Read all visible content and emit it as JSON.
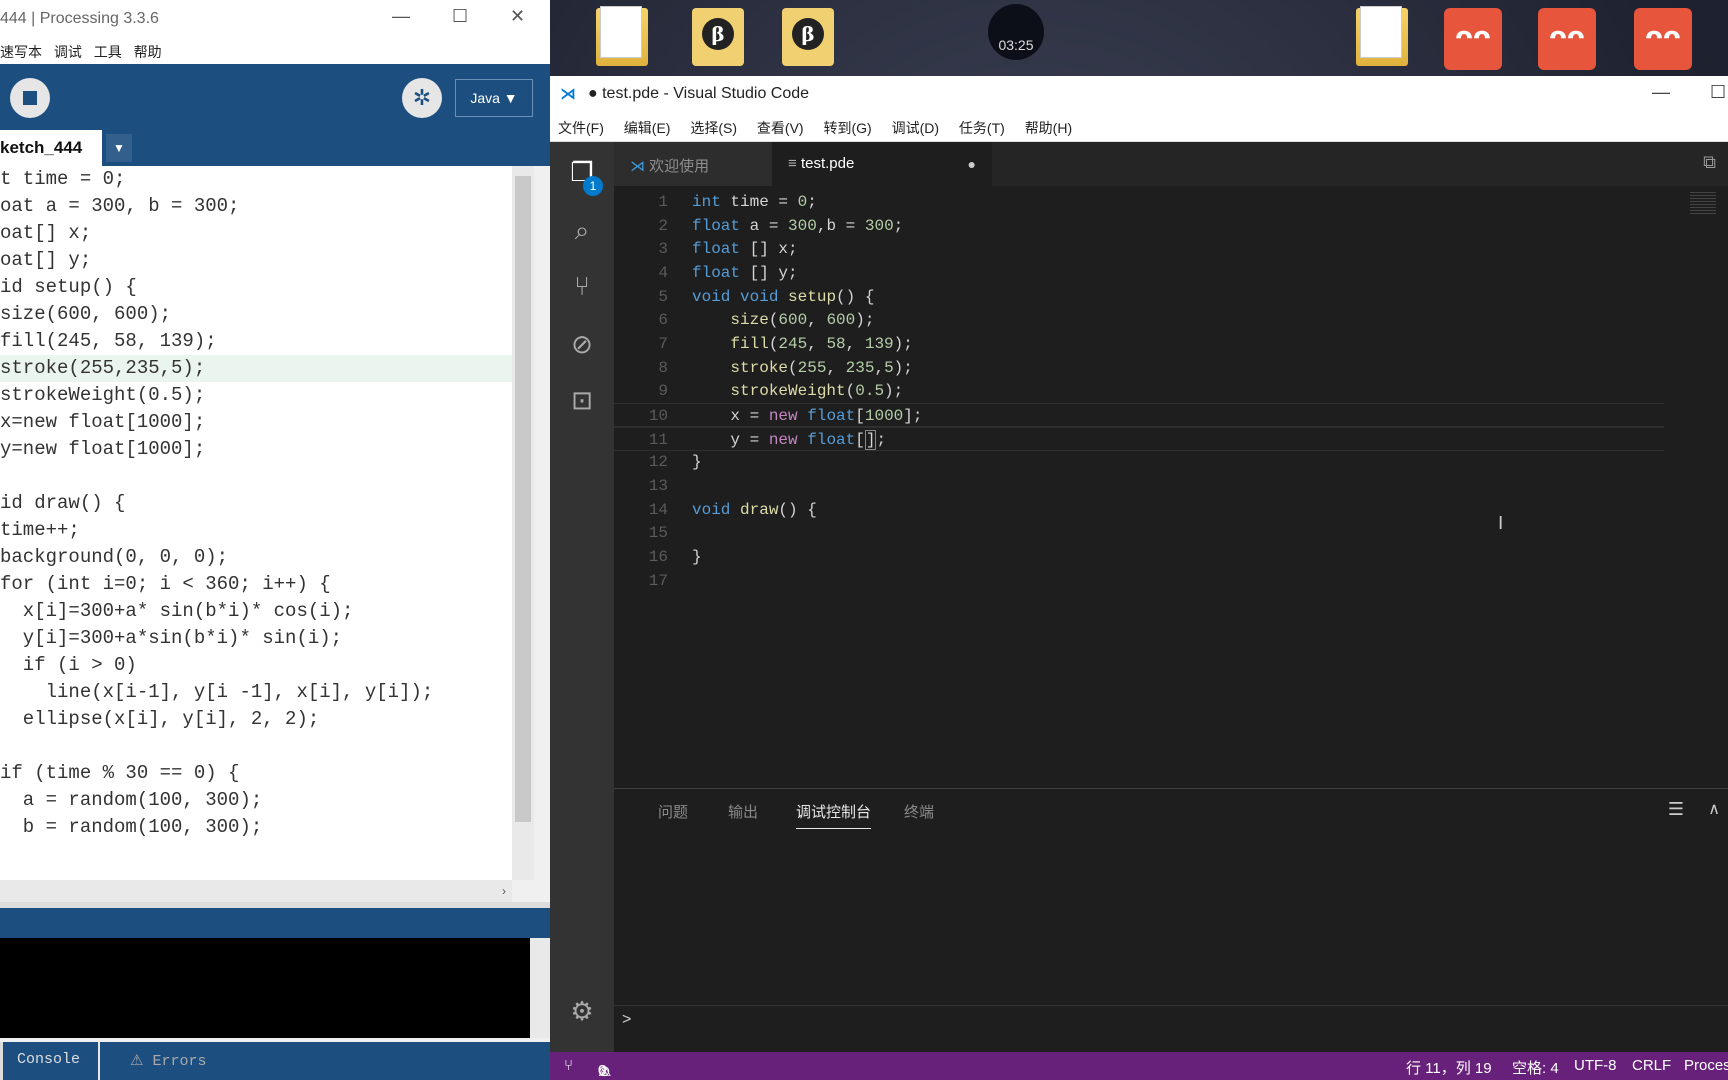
{
  "desktop": {
    "clock": "03:25"
  },
  "processing": {
    "title": "444 | Processing 3.3.6",
    "menu": [
      "速写本",
      "调试",
      "工具",
      "帮助"
    ],
    "mode": "Java ▼",
    "tab": "ketch_444",
    "code_lines": [
      "t time = 0;",
      "oat a = 300, b = 300;",
      "oat[] x;",
      "oat[] y;",
      "id setup() {",
      "size(600, 600);",
      "fill(245, 58, 139);",
      "stroke(255,235,5);",
      "strokeWeight(0.5);",
      "x=new float[1000];",
      "y=new float[1000];",
      "",
      "id draw() {",
      "time++;",
      "background(0, 0, 0);",
      "for (int i=0; i < 360; i++) {",
      "  x[i]=300+a* sin(b*i)* cos(i);",
      "  y[i]=300+a*sin(b*i)* sin(i);",
      "  if (i > 0)",
      "    line(x[i-1], y[i -1], x[i], y[i]);",
      "  ellipse(x[i], y[i], 2, 2);",
      "",
      "if (time % 30 == 0) {",
      "  a = random(100, 300);",
      "  b = random(100, 300);",
      ""
    ],
    "console_tab": "Console",
    "errors_tab": "Errors"
  },
  "vscode": {
    "title": "● test.pde - Visual Studio Code",
    "menu": [
      "文件(F)",
      "编辑(E)",
      "选择(S)",
      "查看(V)",
      "转到(G)",
      "调试(D)",
      "任务(T)",
      "帮助(H)"
    ],
    "tabs": {
      "welcome": "欢迎使用",
      "file": "test.pde"
    },
    "explorer_badge": "1",
    "line_numbers": [
      "1",
      "2",
      "3",
      "4",
      "5",
      "6",
      "7",
      "8",
      "9",
      "10",
      "11",
      "12",
      "13",
      "14",
      "15",
      "16",
      "17"
    ],
    "panel_tabs": [
      "问题",
      "输出",
      "调试控制台",
      "终端"
    ],
    "panel_prompt": ">",
    "status": {
      "errors": "0",
      "warnings": "0",
      "position": "行 11，列 19",
      "spaces": "空格: 4",
      "encoding": "UTF-8",
      "eol": "CRLF",
      "language": "Proces"
    },
    "colors": {
      "status_bar": "#68217a",
      "editor_bg": "#1e1e1e"
    }
  }
}
